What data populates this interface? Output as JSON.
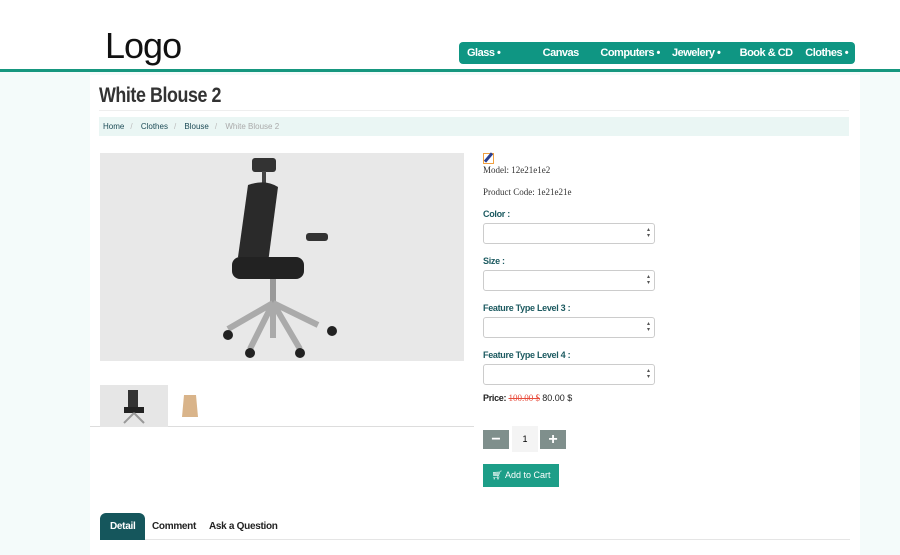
{
  "header": {
    "logo": "Logo",
    "nav": [
      {
        "label": "Glass",
        "dropdown": true
      },
      {
        "label": "Canvas",
        "dropdown": false
      },
      {
        "label": "Computers",
        "dropdown": true
      },
      {
        "label": "Jewelery",
        "dropdown": true
      },
      {
        "label": "Book & CD",
        "dropdown": false
      },
      {
        "label": "Clothes",
        "dropdown": true
      }
    ]
  },
  "page": {
    "title": "White Blouse 2",
    "breadcrumb": [
      "Home",
      "Clothes",
      "Blouse",
      "White Blouse 2"
    ]
  },
  "product": {
    "model": "Model: 12e21e1e2",
    "code": "Product Code: 1e21e21e",
    "options": [
      {
        "label": "Color :",
        "value": ""
      },
      {
        "label": "Size :",
        "value": ""
      },
      {
        "label": "Feature Type Level 3 :",
        "value": ""
      },
      {
        "label": "Feature Type Level 4 :",
        "value": ""
      }
    ],
    "price_label": "Price:",
    "old_price": "100.00 $",
    "price": "80.00 $",
    "quantity": "1",
    "minus": "−",
    "plus": "+",
    "add_to_cart": "Add to Cart"
  },
  "tabs": [
    "Detail",
    "Comment",
    "Ask a Question"
  ],
  "colors": {
    "accent": "#0f9683",
    "dark_teal": "#15565c",
    "old_price": "#e74c3c"
  }
}
